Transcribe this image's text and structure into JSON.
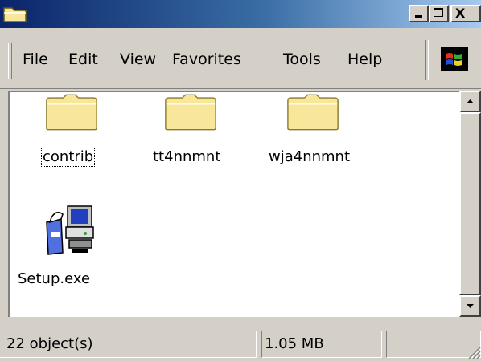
{
  "window": {
    "title_icon": "folder-icon",
    "controls": {
      "minimize_icon": "minimize-icon",
      "maximize_icon": "maximize-icon",
      "close_label": "X"
    }
  },
  "menubar": {
    "items": [
      "File",
      "Edit",
      "View",
      "Favorites",
      "Tools",
      "Help"
    ],
    "logo_icon": "windows-logo-icon"
  },
  "content": {
    "items": [
      {
        "name": "contrib",
        "icon": "folder-icon",
        "selected": true
      },
      {
        "name": "tt4nnmnt",
        "icon": "folder-icon"
      },
      {
        "name": "wja4nnmnt",
        "icon": "folder-icon"
      },
      {
        "name": "Setup.exe",
        "icon": "setup-installer-icon"
      }
    ]
  },
  "statusbar": {
    "objects": "22 object(s)",
    "size": "1.05 MB"
  },
  "colors": {
    "title_gradient_start": "#0a246a",
    "title_gradient_end": "#a6caf0",
    "folder_fill": "#f8e79a",
    "chrome": "#d4d0c8"
  }
}
